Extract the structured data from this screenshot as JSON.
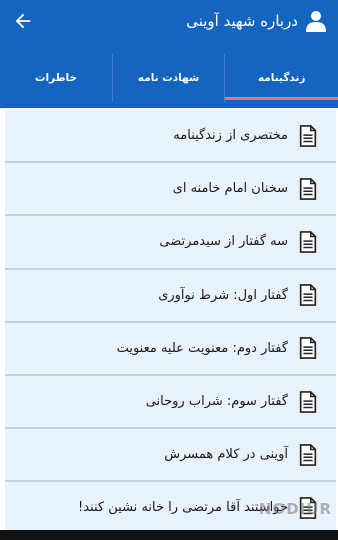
{
  "header": {
    "title": "درباره شهید آوینی",
    "back_icon": "arrow-left-icon",
    "user_icon": "person-icon"
  },
  "tabs": [
    {
      "label": "زندگینامه",
      "selected": true
    },
    {
      "label": "شهادت نامه",
      "selected": false
    },
    {
      "label": "خاطرات",
      "selected": false
    }
  ],
  "list": {
    "item_icon": "document-icon",
    "items": [
      {
        "label": "مختصری از زندگینامه"
      },
      {
        "label": "سخنان امام خامنه ای"
      },
      {
        "label": "سه گفتار از سیدمرتضی"
      },
      {
        "label": "گفتار اول: شرط نوآوری"
      },
      {
        "label": "گفتار دوم: معنویت علیه معنویت"
      },
      {
        "label": "گفتار سوم: شراب روحانی"
      },
      {
        "label": "آوینی در کلام همسرش"
      },
      {
        "label": "خواستند آقا مرتضی را خانه نشین کنند!"
      }
    ]
  },
  "watermark": "NODIUR",
  "colors": {
    "appbar": "#1565c0",
    "tab_indicator": "#e57373",
    "list_background": "#e8f2fb"
  }
}
